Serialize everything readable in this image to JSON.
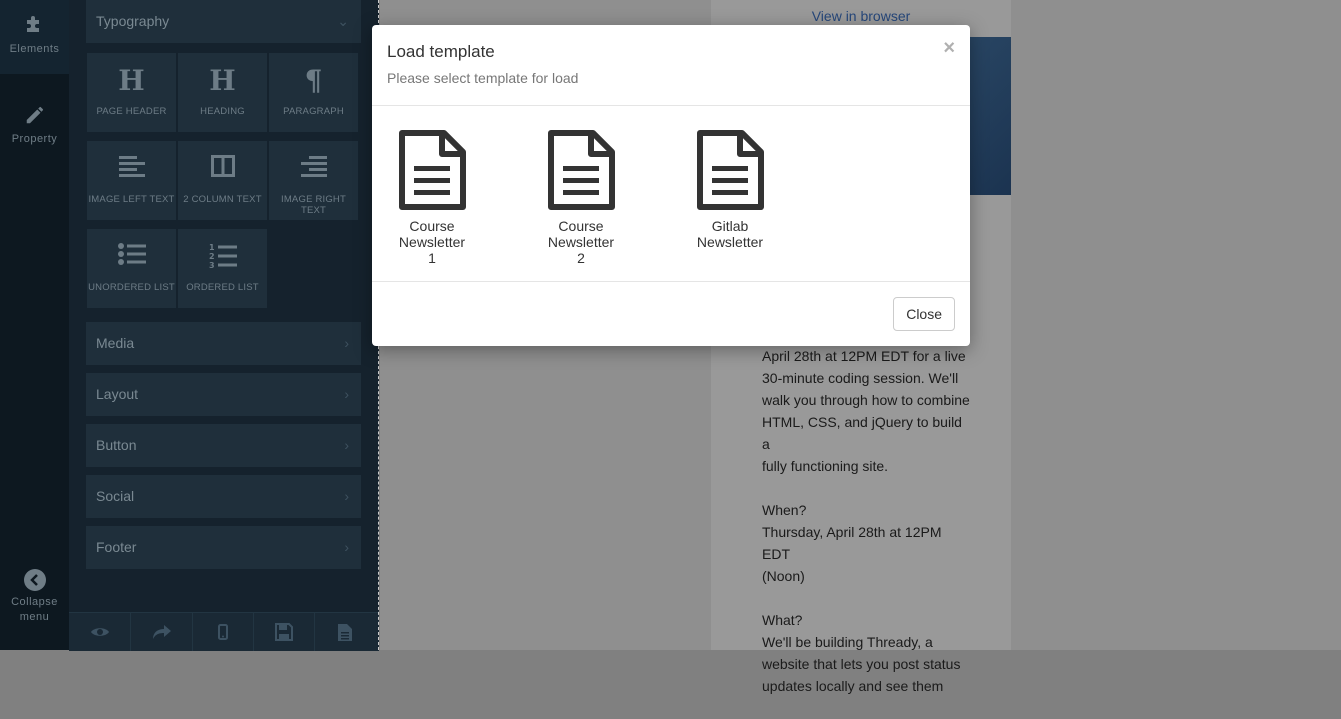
{
  "rail": {
    "elements_label": "Elements",
    "property_label": "Property",
    "collapse_label_1": "Collapse",
    "collapse_label_2": "menu"
  },
  "panel": {
    "typography_label": "Typography",
    "tiles": [
      {
        "label": "PAGE HEADER",
        "icon": "H"
      },
      {
        "label": "HEADING",
        "icon": "H"
      },
      {
        "label": "PARAGRAPH",
        "icon": "¶"
      },
      {
        "label": "IMAGE LEFT TEXT"
      },
      {
        "label": "2 COLUMN TEXT"
      },
      {
        "label": "IMAGE RIGHT TEXT"
      },
      {
        "label": "UNORDERED LIST"
      },
      {
        "label": "ORDERED LIST"
      }
    ],
    "categories": [
      {
        "label": "Media"
      },
      {
        "label": "Layout"
      },
      {
        "label": "Button"
      },
      {
        "label": "Social"
      },
      {
        "label": "Footer"
      }
    ],
    "chevron": "›",
    "typography_chevron": "⌄"
  },
  "email": {
    "view_in_browser": "View in browser",
    "lines_block1": [
      "April 28th at 12PM EDT for a live",
      "30-minute coding session. We'll",
      "walk you through how to combine",
      "HTML, CSS, and jQuery to build a",
      "fully functioning site."
    ],
    "lines_block2": [
      "When?",
      "Thursday, April 28th at 12PM EDT",
      "(Noon)"
    ],
    "lines_block3": [
      "What?",
      "We'll be building Thready, a",
      "website that lets you post status",
      "updates locally and see them"
    ]
  },
  "modal": {
    "title": "Load template",
    "subtitle": "Please select template for load",
    "close_x": "×",
    "templates": [
      {
        "label": "Course Newsletter 1"
      },
      {
        "label": "Course Newsletter 2"
      },
      {
        "label": "Gitlab Newsletter"
      }
    ],
    "close_button": "Close"
  },
  "colors": {
    "rail_bg": "#0d1820",
    "panel_bg": "#15222d",
    "tile_bg": "#1f2f3b",
    "link": "#26477a"
  }
}
